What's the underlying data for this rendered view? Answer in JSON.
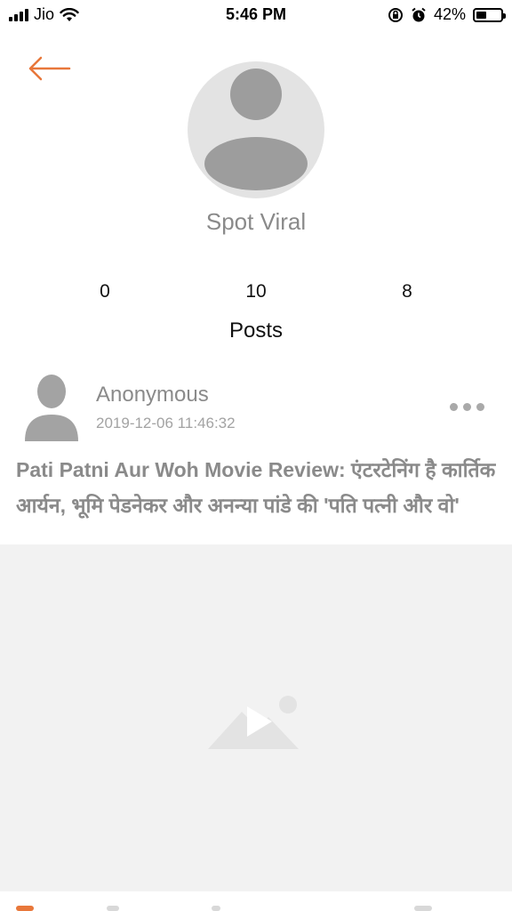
{
  "status_bar": {
    "carrier": "Jio",
    "time": "5:46 PM",
    "battery_percent": "42%",
    "battery_level": 0.42
  },
  "header": {
    "back_icon": "arrow-left-icon",
    "accent_color": "#e8773a"
  },
  "profile": {
    "name": "Spot Viral",
    "stats": [
      "0",
      "10",
      "8"
    ],
    "section_label": "Posts"
  },
  "post": {
    "author": "Anonymous",
    "timestamp": "2019-12-06 11:46:32",
    "title": "Pati Patni Aur Woh Movie Review: एंटरटेनिंग है कार्तिक आर्यन, भूमि पेडनेकर और अनन्या पांडे की 'पति पत्नी और वो'",
    "more_icon": "more-dots-icon",
    "media_icon": "video-placeholder-icon"
  }
}
